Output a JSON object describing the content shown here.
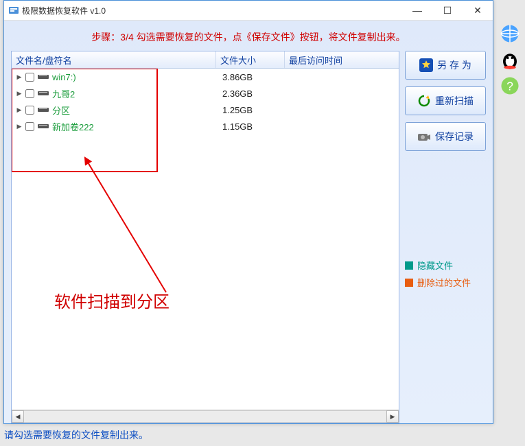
{
  "window": {
    "title": "极限数据恢复软件 v1.0"
  },
  "step_text": "步骤：3/4 勾选需要恢复的文件，点《保存文件》按钮，将文件复制出来。",
  "columns": {
    "name": "文件名/盘符名",
    "size": "文件大小",
    "time": "最后访问时间"
  },
  "rows": [
    {
      "name": "win7:)",
      "size": "3.86GB"
    },
    {
      "name": "九哥2",
      "size": "2.36GB"
    },
    {
      "name": "分区",
      "size": "1.25GB"
    },
    {
      "name": "新加卷222",
      "size": "1.15GB"
    }
  ],
  "buttons": {
    "save_as": "另 存 为",
    "rescan": "重新扫描",
    "save_log": "保存记录"
  },
  "legend": {
    "hidden": "隐藏文件",
    "deleted": "删除过的文件"
  },
  "annotation": "软件扫描到分区",
  "status": "请勾选需要恢复的文件复制出来。"
}
